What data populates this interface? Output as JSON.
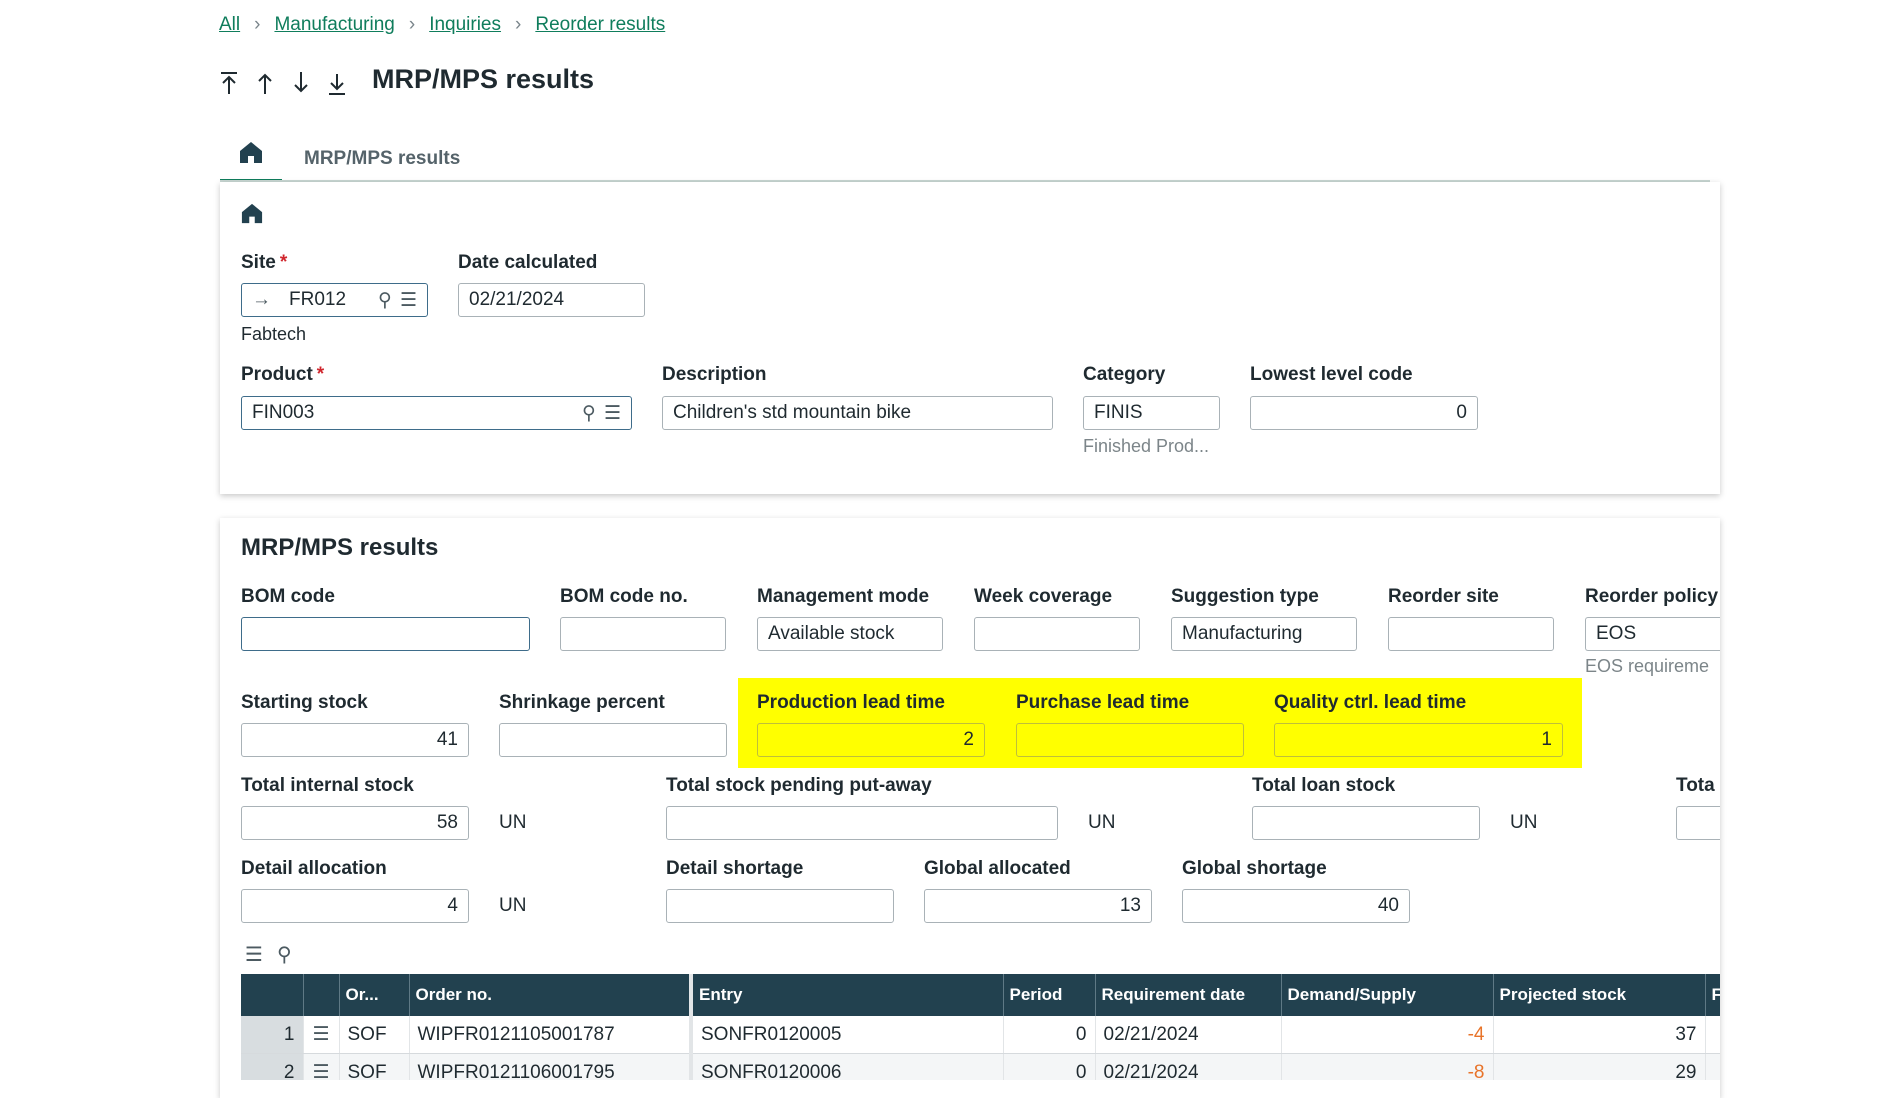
{
  "breadcrumb": [
    "All",
    "Manufacturing",
    "Inquiries",
    "Reorder results"
  ],
  "page_title": "MRP/MPS results",
  "tab_label": "MRP/MPS results",
  "header": {
    "site_label": "Site",
    "site_value": "FR012",
    "site_name": "Fabtech",
    "date_label": "Date calculated",
    "date_value": "02/21/2024",
    "product_label": "Product",
    "product_value": "FIN003",
    "description_label": "Description",
    "description_value": "Children's std mountain bike",
    "category_label": "Category",
    "category_value": "FINIS",
    "category_sub": "Finished Prod...",
    "lowest_label": "Lowest level code",
    "lowest_value": "0"
  },
  "results": {
    "section_title": "MRP/MPS results",
    "bom_code_label": "BOM code",
    "bom_code_value": "",
    "bom_no_label": "BOM code no.",
    "bom_no_value": "",
    "mgmt_label": "Management mode",
    "mgmt_value": "Available stock",
    "week_label": "Week coverage",
    "week_value": "",
    "suggestion_label": "Suggestion type",
    "suggestion_value": "Manufacturing",
    "reorder_site_label": "Reorder site",
    "reorder_site_value": "",
    "reorder_policy_label": "Reorder policy",
    "reorder_policy_value": "EOS",
    "reorder_policy_sub": "EOS requireme",
    "starting_stock_label": "Starting stock",
    "starting_stock_value": "41",
    "shrinkage_label": "Shrinkage percent",
    "shrinkage_value": "",
    "prod_lead_label": "Production lead time",
    "prod_lead_value": "2",
    "purch_lead_label": "Purchase lead time",
    "purch_lead_value": "",
    "qc_lead_label": "Quality ctrl. lead time",
    "qc_lead_value": "1",
    "total_internal_label": "Total internal stock",
    "total_internal_value": "58",
    "pending_label": "Total stock pending put-away",
    "pending_value": "",
    "loan_label": "Total loan stock",
    "loan_value": "",
    "tota_label": "Tota",
    "unit": "UN",
    "detail_alloc_label": "Detail allocation",
    "detail_alloc_value": "4",
    "detail_short_label": "Detail shortage",
    "detail_short_value": "",
    "global_alloc_label": "Global allocated",
    "global_alloc_value": "13",
    "global_short_label": "Global shortage",
    "global_short_value": "40"
  },
  "grid": {
    "columns": [
      "Or...",
      "Order no.",
      "Entry",
      "Period",
      "Requirement date",
      "Demand/Supply",
      "Projected stock",
      "F"
    ],
    "rows": [
      {
        "n": "1",
        "or": "SOF",
        "order": "WIPFR0121105001787",
        "entry": "SONFR0120005",
        "period": "0",
        "date": "02/21/2024",
        "ds": "-4",
        "proj": "37"
      },
      {
        "n": "2",
        "or": "SOF",
        "order": "WIPFR0121106001795",
        "entry": "SONFR0120006",
        "period": "0",
        "date": "02/21/2024",
        "ds": "-8",
        "proj": "29"
      }
    ]
  },
  "colors": {
    "accent": "#0f7d5c",
    "grid_header": "#22414f",
    "highlight": "#ffff00",
    "negative": "#e8742a"
  }
}
